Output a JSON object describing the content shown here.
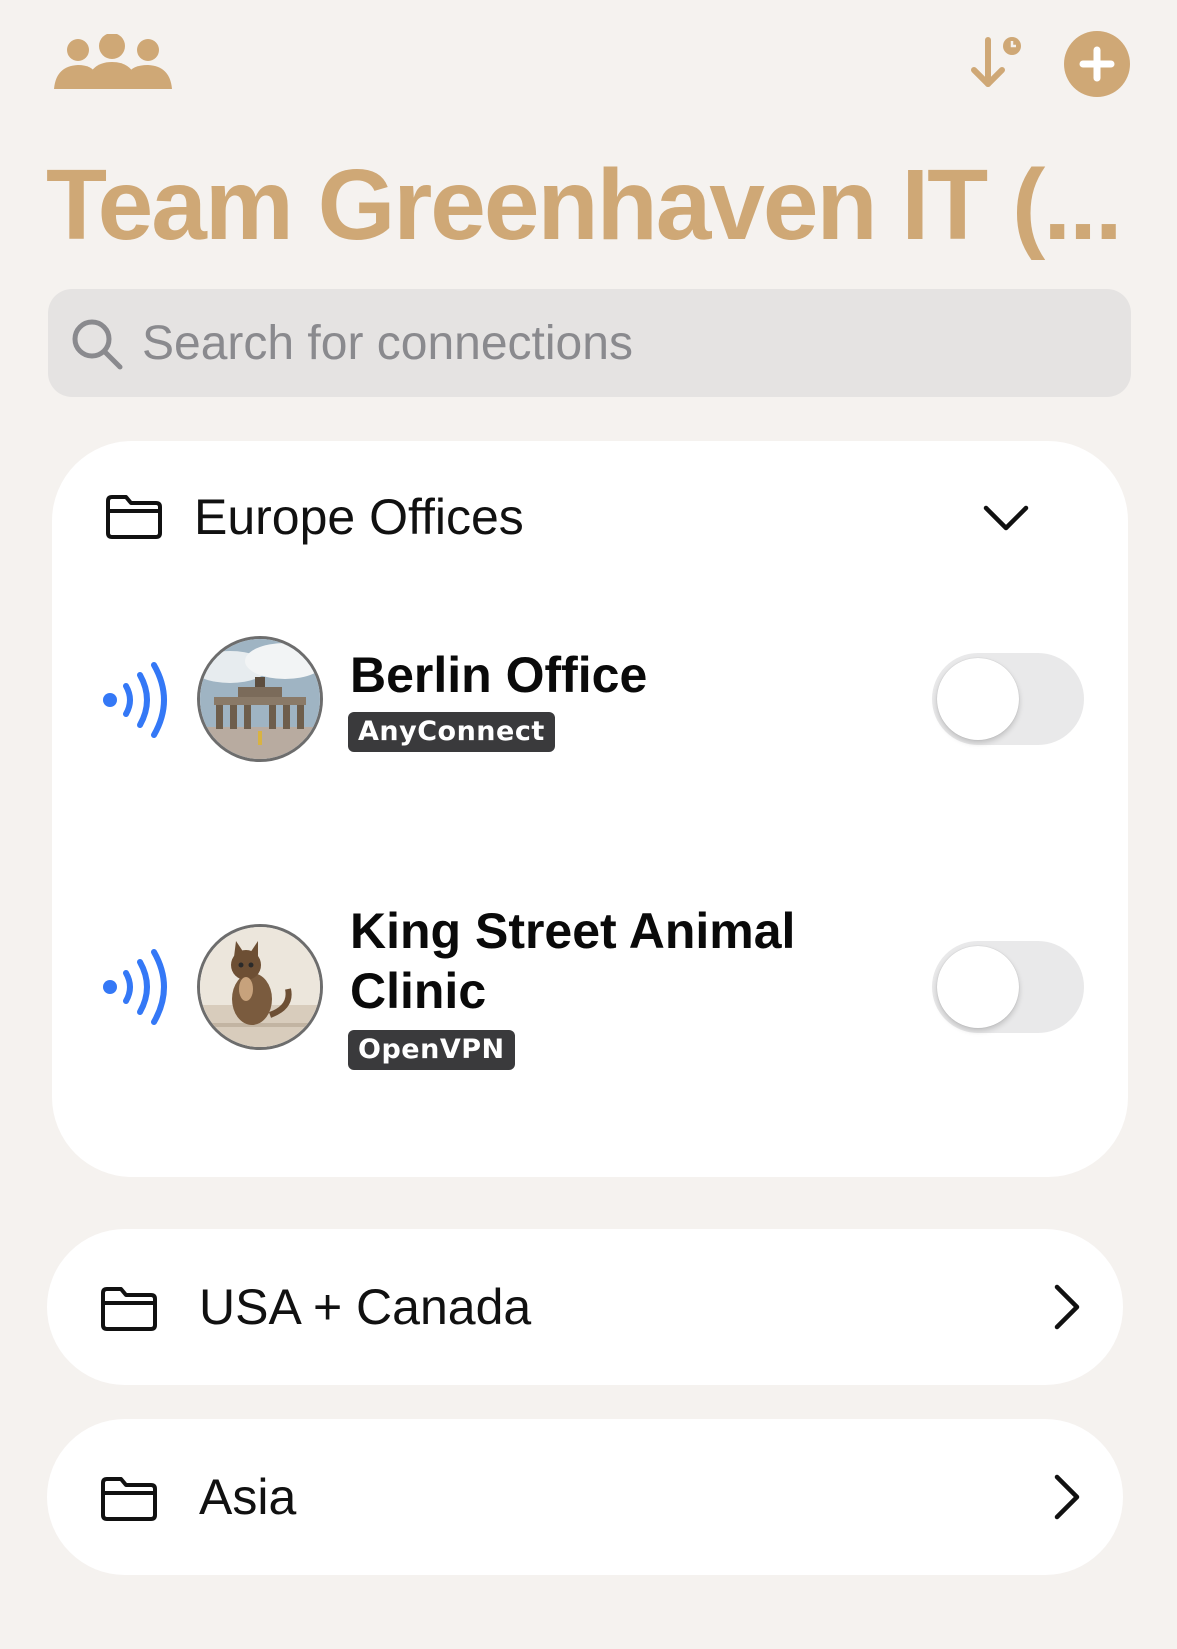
{
  "header": {
    "title": "Team Greenhaven IT (...",
    "icons": [
      "team-icon",
      "sort-icon",
      "add-icon"
    ]
  },
  "search": {
    "placeholder": "Search for connections"
  },
  "groups": [
    {
      "name": "Europe Offices",
      "expanded": true,
      "connections": [
        {
          "name": "Berlin Office",
          "protocol": "AnyConnect",
          "enabled": false,
          "avatar": "brandenburg-gate-photo"
        },
        {
          "name": "King Street Animal Clinic",
          "protocol": "OpenVPN",
          "enabled": false,
          "avatar": "cat-photo"
        }
      ]
    },
    {
      "name": "USA + Canada",
      "expanded": false
    },
    {
      "name": "Asia",
      "expanded": false
    }
  ],
  "colors": {
    "accent": "#cfa876",
    "signal": "#3478f6",
    "background": "#f5f2ef",
    "badge": "#3a3a3c"
  }
}
